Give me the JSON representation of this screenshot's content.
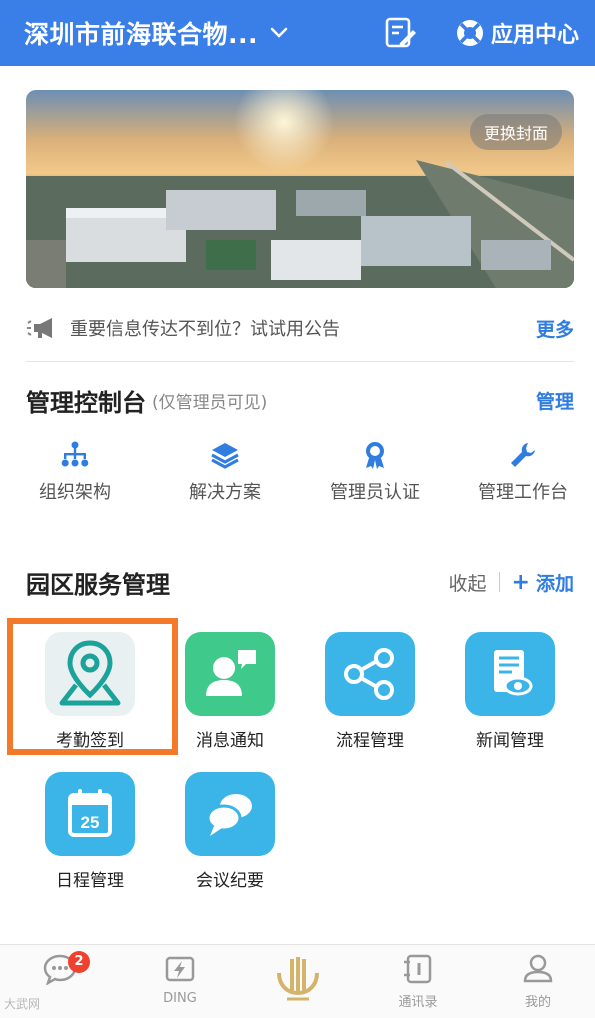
{
  "header": {
    "org_name": "深圳市前海联合物...",
    "app_center_label": "应用中心",
    "bg_color": "#3a7ee8"
  },
  "banner": {
    "change_cover_label": "更换封面"
  },
  "notice": {
    "text": "重要信息传达不到位？试试用公告",
    "more_label": "更多"
  },
  "admin": {
    "title": "管理控制台",
    "note": "(仅管理员可见)",
    "manage_label": "管理",
    "tools": [
      {
        "label": "组织架构",
        "icon": "org-structure-icon"
      },
      {
        "label": "解决方案",
        "icon": "layers-icon"
      },
      {
        "label": "管理员认证",
        "icon": "badge-icon"
      },
      {
        "label": "管理工作台",
        "icon": "wrench-icon"
      }
    ]
  },
  "services": {
    "title": "园区服务管理",
    "collapse_label": "收起",
    "add_label": "添加",
    "apps": [
      {
        "label": "考勤签到",
        "icon": "location-pin-icon",
        "color": "#e9f0f2"
      },
      {
        "label": "消息通知",
        "icon": "contact-message-icon",
        "color": "#3fc98a"
      },
      {
        "label": "流程管理",
        "icon": "share-icon",
        "color": "#3bb5e8"
      },
      {
        "label": "新闻管理",
        "icon": "news-icon",
        "color": "#3bb5e8"
      },
      {
        "label": "日程管理",
        "icon": "calendar-icon",
        "color": "#3bb5e8",
        "day": "25"
      },
      {
        "label": "会议纪要",
        "icon": "chat-bubbles-icon",
        "color": "#3bb5e8"
      }
    ],
    "highlight_color": "#f27a2a"
  },
  "tabbar": {
    "tabs": [
      {
        "label": "",
        "icon": "message-icon",
        "badge": "2"
      },
      {
        "label": "DING",
        "icon": "ding-icon"
      },
      {
        "label": "",
        "icon": "workbench-logo-icon"
      },
      {
        "label": "通讯录",
        "icon": "contacts-icon"
      },
      {
        "label": "我的",
        "icon": "profile-icon"
      }
    ]
  },
  "watermark": "大武网"
}
